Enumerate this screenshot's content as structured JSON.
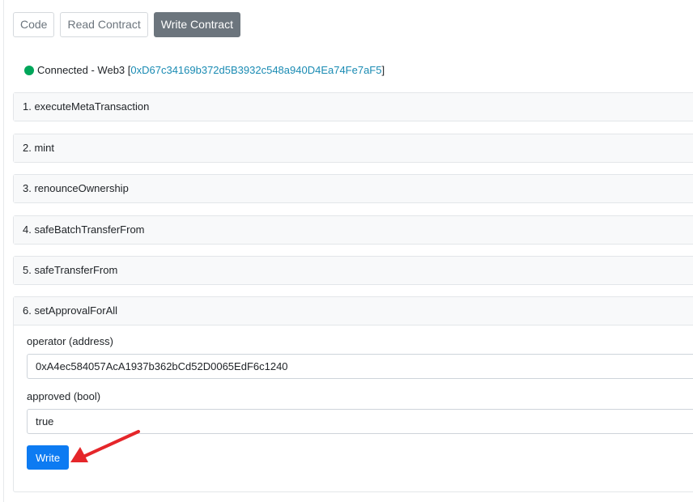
{
  "tabs": [
    {
      "label": "Code",
      "active": false
    },
    {
      "label": "Read Contract",
      "active": false
    },
    {
      "label": "Write Contract",
      "active": true
    }
  ],
  "connection": {
    "prefix": "Connected - Web3 [",
    "address": "0xD67c34169b372d5B3932c548a940D4Ea74Fe7aF5",
    "suffix": "]",
    "status_color": "#00a65a"
  },
  "functions": [
    {
      "label": "1. executeMetaTransaction"
    },
    {
      "label": "2. mint"
    },
    {
      "label": "3. renounceOwnership"
    },
    {
      "label": "4. safeBatchTransferFrom"
    },
    {
      "label": "5. safeTransferFrom"
    },
    {
      "label": "6. setApprovalForAll"
    }
  ],
  "open_function": {
    "fields": [
      {
        "label": "operator (address)",
        "value": "0xA4ec584057AcA1937b362bCd52D0065EdF6c1240"
      },
      {
        "label": "approved (bool)",
        "value": "true"
      }
    ],
    "write_label": "Write"
  },
  "colors": {
    "accent": "#0d7bf2",
    "link": "#1a8bb3",
    "annotation_arrow": "#e5262a"
  }
}
